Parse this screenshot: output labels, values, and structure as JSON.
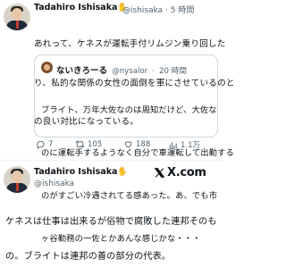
{
  "top_tweet": {
    "author_name": "Tadahiro Ishisaka",
    "author_hand": "✋",
    "author_handle": "@ishisaka",
    "separator": "·",
    "time": "5 時間",
    "text_lines": [
      "あれって、ケネスが運転手付リムジン乗り回した",
      "り、私的な関係の女性の面倒を軍にさせているのと",
      "の良い対比になっている。"
    ]
  },
  "quote": {
    "author_name": "ないきろーる",
    "author_handle": "@nysalor",
    "separator": "·",
    "time": "20 時間",
    "text_lines": [
      "ブライト、万年大佐なのは周知だけど、大佐な",
      "のに運転手するようなく自分で車運転して出勤する",
      "のがすごい冷遇されてる感あった。あ、でも市",
      "ヶ谷勤務の一佐とかあんな感じかな・・・"
    ]
  },
  "actions": {
    "replies": "7",
    "retweets": "105",
    "likes": "188",
    "views": "1.1万"
  },
  "bottom_tweet": {
    "author_name": "Tadahiro Ishisaka",
    "author_hand": "✋",
    "author_handle": "@ishisaka",
    "text_lines": [
      "ケネスは仕事は出来るが俗物で腐敗した連邦そのも",
      "の。ブライトは連邦の善の部分の代表。"
    ]
  },
  "branding": {
    "logo_text": "X.com"
  }
}
